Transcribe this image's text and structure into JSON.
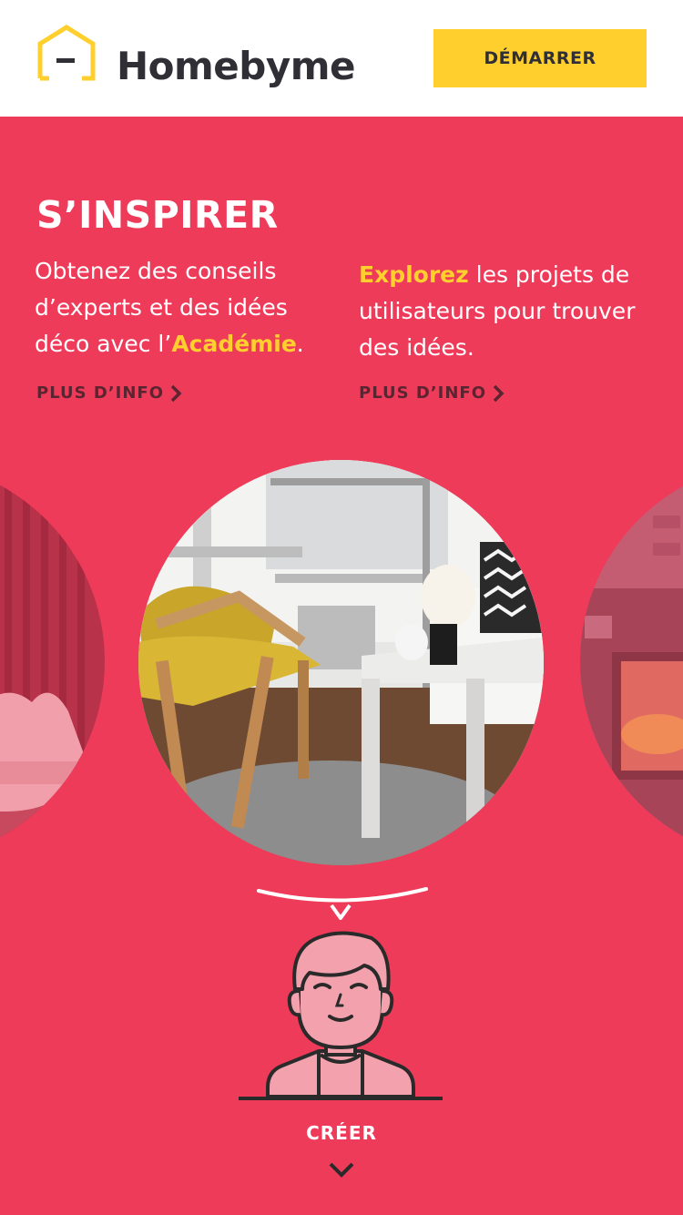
{
  "header": {
    "logo_text": "Homebyme",
    "start_button_label": "DÉMARRER",
    "logo_color": "#ffcf2e"
  },
  "inspire": {
    "title": "S’INSPIRER",
    "left": {
      "text_before": "Obtenez des conseils d’experts et des idées déco avec l’",
      "highlight": "Académie",
      "text_after": ".",
      "link_label": "PLUS D’INFO"
    },
    "right": {
      "highlight": "Explorez",
      "text_after": " les projets de utilisateurs pour trouver des idées.",
      "link_label": "PLUS D’INFO"
    }
  },
  "carousel": {
    "slides": [
      {
        "icon": "pink-armchair-room-image"
      },
      {
        "icon": "living-room-yellow-chair-image"
      },
      {
        "icon": "fireplace-stove-image"
      }
    ]
  },
  "create": {
    "label": "CRÉER",
    "icon": "chevron-down-icon"
  },
  "colors": {
    "background": "#ef3b5a",
    "accent": "#ffcf2e",
    "link": "#5a2530"
  }
}
